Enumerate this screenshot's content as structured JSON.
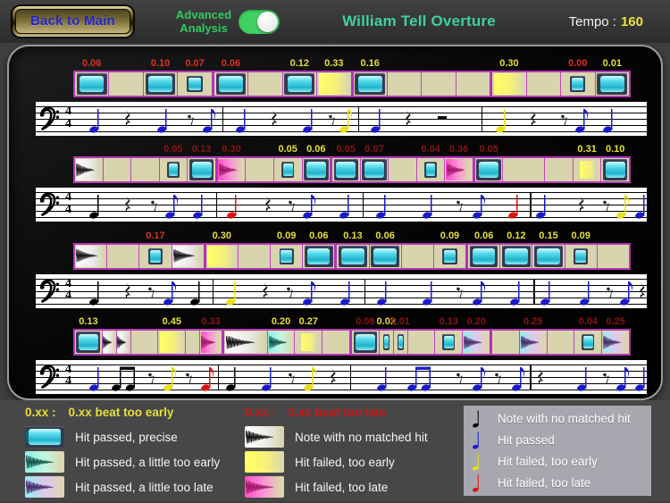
{
  "topbar": {
    "back_label": "Back to Main",
    "toggle_label_line1": "Advanced",
    "toggle_label_line2": "Analysis",
    "toggle_state": "on",
    "title": "William Tell Overture",
    "tempo_label": "Tempo :",
    "tempo_value": "160"
  },
  "staff": {
    "clef": "bass",
    "time_top": "4",
    "time_bottom": "4"
  },
  "colors": {
    "accent_green": "#3ed29b",
    "toggle_green": "#3fd062",
    "tempo_yellow": "#efe23e",
    "early_yellow": "#e8df3a",
    "late_red": "#e03020",
    "late_dark_red": "#8c1414",
    "cell_bg": "#d8d4ae",
    "cell_border": "#c044c0",
    "hit_cyan": "#2fc4d8",
    "fail_pink": "#ff4ec4",
    "fail_yellow": "#ffff66",
    "note_blue": "#1a1acc",
    "note_red": "#e01010"
  },
  "rows": [
    {
      "cells": [
        {
          "t": "precise",
          "n": "0.06",
          "nc": "r"
        },
        {
          "t": "empty"
        },
        {
          "t": "precise",
          "n": "0.10",
          "nc": "r"
        },
        {
          "t": "small",
          "n": "0.07",
          "nc": "r"
        },
        {
          "t": "precise",
          "n": "0.06",
          "nc": "r",
          "m": 1
        },
        {
          "t": "empty"
        },
        {
          "t": "precise",
          "n": "0.12",
          "nc": "y"
        },
        {
          "t": "fail_early",
          "n": "0.33",
          "nc": "y"
        },
        {
          "t": "precise",
          "n": "0.16",
          "nc": "y",
          "m": 1
        },
        {
          "t": "empty"
        },
        {
          "t": "empty"
        },
        {
          "t": "empty"
        },
        {
          "t": "fail_early",
          "n": "0.30",
          "nc": "y",
          "m": 1
        },
        {
          "t": "empty"
        },
        {
          "t": "small",
          "n": "0.00",
          "nc": "r"
        },
        {
          "t": "precise",
          "n": "0.01",
          "nc": "y"
        }
      ],
      "notes": [
        {
          "x": 9.5,
          "g": "q",
          "c": "blue"
        },
        {
          "x": 15,
          "g": "rq"
        },
        {
          "x": 20.6,
          "g": "q",
          "c": "blue"
        },
        {
          "x": 25.5,
          "g": "re"
        },
        {
          "x": 28,
          "g": "e",
          "c": "blue"
        },
        {
          "x": 30.6,
          "g": "bar"
        },
        {
          "x": 33.5,
          "g": "q",
          "c": "blue"
        },
        {
          "x": 39,
          "g": "rq"
        },
        {
          "x": 44.5,
          "g": "q",
          "c": "blue"
        },
        {
          "x": 48.5,
          "g": "re"
        },
        {
          "x": 50.5,
          "g": "e",
          "c": "yellow"
        },
        {
          "x": 52.8,
          "g": "bar"
        },
        {
          "x": 55.5,
          "g": "q",
          "c": "blue"
        },
        {
          "x": 61,
          "g": "rq"
        },
        {
          "x": 66.5,
          "g": "rh"
        },
        {
          "x": 73,
          "g": "bar"
        },
        {
          "x": 76,
          "g": "q",
          "c": "yellow"
        },
        {
          "x": 81.5,
          "g": "rq"
        },
        {
          "x": 86.5,
          "g": "re"
        },
        {
          "x": 89,
          "g": "e",
          "c": "blue"
        },
        {
          "x": 93.5,
          "g": "q",
          "c": "blue"
        }
      ]
    },
    {
      "cells": [
        {
          "t": "no_hit"
        },
        {
          "t": "empty"
        },
        {
          "t": "empty"
        },
        {
          "t": "small",
          "n": "0.05",
          "nc": "dr"
        },
        {
          "t": "precise",
          "n": "0.13",
          "nc": "dr"
        },
        {
          "t": "fail_late",
          "n": "0.30",
          "nc": "dr",
          "m": 1
        },
        {
          "t": "empty"
        },
        {
          "t": "small",
          "n": "0.05",
          "nc": "y"
        },
        {
          "t": "precise",
          "n": "0.06",
          "nc": "y"
        },
        {
          "t": "precise",
          "n": "0.05",
          "nc": "dr",
          "m": 1
        },
        {
          "t": "precise",
          "n": "0.07",
          "nc": "dr"
        },
        {
          "t": "empty"
        },
        {
          "t": "small",
          "n": "0.04",
          "nc": "dr"
        },
        {
          "t": "fail_late",
          "n": "0.36",
          "nc": "dr"
        },
        {
          "t": "precise",
          "n": "0.05",
          "nc": "dr",
          "m": 1
        },
        {
          "t": "empty",
          "w": 1.5
        },
        {
          "t": "empty"
        },
        {
          "t": "small_fail_early",
          "n": "0.31",
          "nc": "y"
        },
        {
          "t": "precise",
          "n": "0.10",
          "nc": "y"
        }
      ],
      "notes": [
        {
          "x": 9.5,
          "g": "q",
          "c": "black"
        },
        {
          "x": 15,
          "g": "rq"
        },
        {
          "x": 19.5,
          "g": "re"
        },
        {
          "x": 22,
          "g": "e",
          "c": "blue"
        },
        {
          "x": 26.5,
          "g": "q",
          "c": "blue"
        },
        {
          "x": 29.5,
          "g": "bar"
        },
        {
          "x": 32,
          "g": "q",
          "c": "red"
        },
        {
          "x": 38,
          "g": "rq"
        },
        {
          "x": 42,
          "g": "re"
        },
        {
          "x": 44.5,
          "g": "e",
          "c": "blue"
        },
        {
          "x": 50.5,
          "g": "q",
          "c": "blue"
        },
        {
          "x": 53.5,
          "g": "bar"
        },
        {
          "x": 56.5,
          "g": "q",
          "c": "blue"
        },
        {
          "x": 64,
          "g": "q",
          "c": "blue"
        },
        {
          "x": 69.5,
          "g": "re"
        },
        {
          "x": 72.2,
          "g": "e",
          "c": "blue"
        },
        {
          "x": 78,
          "g": "q",
          "c": "red"
        },
        {
          "x": 80.8,
          "g": "barH"
        },
        {
          "x": 82.6,
          "g": "q",
          "c": "blue"
        },
        {
          "x": 89.3,
          "g": "rq"
        },
        {
          "x": 93.4,
          "g": "re"
        },
        {
          "x": 95.8,
          "g": "e",
          "c": "yellow"
        },
        {
          "x": 98.8,
          "g": "q",
          "c": "blue"
        }
      ]
    },
    {
      "cells": [
        {
          "t": "no_hit"
        },
        {
          "t": "empty"
        },
        {
          "t": "small",
          "n": "0.17",
          "nc": "r"
        },
        {
          "t": "no_hit"
        },
        {
          "t": "fail_early",
          "n": "0.30",
          "nc": "y",
          "m": 1
        },
        {
          "t": "empty"
        },
        {
          "t": "small",
          "n": "0.09",
          "nc": "y"
        },
        {
          "t": "precise",
          "n": "0.06",
          "nc": "y"
        },
        {
          "t": "precise",
          "n": "0.13",
          "nc": "y",
          "m": 1
        },
        {
          "t": "precise",
          "n": "0.06",
          "nc": "y"
        },
        {
          "t": "empty"
        },
        {
          "t": "small",
          "n": "0.09",
          "nc": "y"
        },
        {
          "t": "precise",
          "n": "0.06",
          "nc": "y",
          "m": 1
        },
        {
          "t": "precise",
          "n": "0.12",
          "nc": "y"
        },
        {
          "t": "precise",
          "n": "0.15",
          "nc": "y"
        },
        {
          "t": "small",
          "n": "0.09",
          "nc": "y"
        },
        {
          "t": "empty"
        }
      ],
      "notes": [
        {
          "x": 9.5,
          "g": "q",
          "c": "black"
        },
        {
          "x": 15,
          "g": "rq"
        },
        {
          "x": 19,
          "g": "re"
        },
        {
          "x": 21.6,
          "g": "e",
          "c": "blue"
        },
        {
          "x": 26,
          "g": "q",
          "c": "black"
        },
        {
          "x": 28.9,
          "g": "bar"
        },
        {
          "x": 31.8,
          "g": "q",
          "c": "yellow"
        },
        {
          "x": 37.5,
          "g": "rq"
        },
        {
          "x": 41.6,
          "g": "re"
        },
        {
          "x": 44.4,
          "g": "e",
          "c": "blue"
        },
        {
          "x": 50.6,
          "g": "q",
          "c": "blue"
        },
        {
          "x": 53.8,
          "g": "bar"
        },
        {
          "x": 56.6,
          "g": "q",
          "c": "blue"
        },
        {
          "x": 64.1,
          "g": "q",
          "c": "blue"
        },
        {
          "x": 69.4,
          "g": "re"
        },
        {
          "x": 72.2,
          "g": "e",
          "c": "blue"
        },
        {
          "x": 78.3,
          "g": "q",
          "c": "blue"
        },
        {
          "x": 81.5,
          "g": "barH"
        },
        {
          "x": 83.3,
          "g": "q",
          "c": "blue"
        },
        {
          "x": 89.7,
          "g": "q",
          "c": "blue"
        },
        {
          "x": 94,
          "g": "re"
        },
        {
          "x": 96.4,
          "g": "e",
          "c": "blue"
        },
        {
          "x": 99.2,
          "g": "rq"
        }
      ]
    },
    {
      "cells": [
        {
          "t": "precise",
          "n": "0.13",
          "nc": "y"
        },
        {
          "t": "no_hit",
          "w": 0.5
        },
        {
          "t": "no_hit",
          "w": 0.5
        },
        {
          "t": "empty"
        },
        {
          "t": "fail_early",
          "n": "0.45",
          "nc": "y"
        },
        {
          "t": "empty",
          "w": 0.5
        },
        {
          "t": "fail_late",
          "n": "0.33",
          "nc": "dr",
          "w": 0.8
        },
        {
          "t": "no_hit",
          "w": 1.6,
          "m": 1
        },
        {
          "t": "early_pass",
          "n": "0.20",
          "nc": "y"
        },
        {
          "t": "small_fail_early",
          "n": "0.27",
          "nc": "y"
        },
        {
          "t": "empty"
        },
        {
          "t": "precise",
          "n": "0.08",
          "nc": "dr",
          "m": 1
        },
        {
          "t": "small",
          "n": "0.02",
          "nc": "y",
          "w": 0.5
        },
        {
          "t": "small",
          "n": "0.01",
          "nc": "dr",
          "w": 0.5
        },
        {
          "t": "empty"
        },
        {
          "t": "small",
          "n": "0.13",
          "nc": "dr"
        },
        {
          "t": "late_pass",
          "n": "0.20",
          "nc": "dr"
        },
        {
          "t": "empty",
          "m": 1
        },
        {
          "t": "late_pass",
          "n": "0.25",
          "nc": "dr"
        },
        {
          "t": "empty"
        },
        {
          "t": "small",
          "n": "0.04",
          "nc": "dr"
        },
        {
          "t": "late_pass",
          "n": "0.25",
          "nc": "dr"
        }
      ],
      "notes": [
        {
          "x": 9.5,
          "g": "q",
          "c": "blue"
        },
        {
          "x": 13.2,
          "g": "b2",
          "c": "black"
        },
        {
          "x": 19,
          "g": "re"
        },
        {
          "x": 21.6,
          "g": "e",
          "c": "yellow"
        },
        {
          "x": 25.2,
          "g": "re"
        },
        {
          "x": 27.8,
          "g": "e",
          "c": "red"
        },
        {
          "x": 29.8,
          "g": "bar"
        },
        {
          "x": 31.8,
          "g": "q",
          "c": "black"
        },
        {
          "x": 37.7,
          "g": "q",
          "c": "blue"
        },
        {
          "x": 42,
          "g": "re"
        },
        {
          "x": 44.6,
          "g": "e",
          "c": "yellow"
        },
        {
          "x": 48.7,
          "g": "rq"
        },
        {
          "x": 51.5,
          "g": "bar"
        },
        {
          "x": 56.6,
          "g": "q",
          "c": "blue"
        },
        {
          "x": 61.5,
          "g": "b2",
          "c": "blue"
        },
        {
          "x": 69.4,
          "g": "re"
        },
        {
          "x": 72.2,
          "g": "e",
          "c": "blue"
        },
        {
          "x": 75.8,
          "g": "re"
        },
        {
          "x": 78.6,
          "g": "e",
          "c": "blue"
        },
        {
          "x": 80.8,
          "g": "barH"
        },
        {
          "x": 82.6,
          "g": "rq"
        },
        {
          "x": 89.3,
          "g": "q",
          "c": "blue"
        },
        {
          "x": 93.4,
          "g": "re"
        },
        {
          "x": 95.8,
          "g": "e",
          "c": "blue"
        },
        {
          "x": 98.8,
          "g": "q",
          "c": "blue"
        }
      ]
    }
  ],
  "legend": {
    "early_header": {
      "code": "0.xx :",
      "text": "0.xx beat too early"
    },
    "late_header": {
      "code": "0.xx :",
      "text": "0.xx beat too late"
    },
    "col1": [
      {
        "icon": "precise",
        "label": "Hit passed, precise"
      },
      {
        "icon": "early_pass",
        "label": "Hit passed, a little too early"
      },
      {
        "icon": "late_pass",
        "label": "Hit passed, a little too late"
      }
    ],
    "col2": [
      {
        "icon": "no_hit",
        "label": "Note with no matched hit"
      },
      {
        "icon": "fail_early",
        "label": "Hit failed, too early"
      },
      {
        "icon": "fail_late",
        "label": "Hit failed, too late"
      }
    ],
    "note_panel": [
      {
        "color": "black",
        "label": "Note with no matched hit"
      },
      {
        "color": "blue",
        "label": "Hit passed"
      },
      {
        "color": "yellow",
        "label": "Hit failed, too early"
      },
      {
        "color": "red",
        "label": "Hit failed, too late"
      }
    ]
  }
}
